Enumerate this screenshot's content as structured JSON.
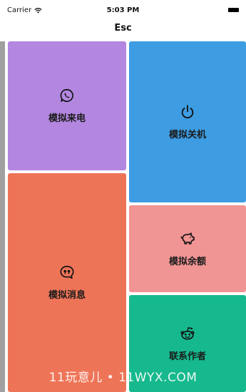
{
  "status_bar": {
    "carrier": "Carrier",
    "time": "5:03 PM"
  },
  "nav": {
    "title": "Esc"
  },
  "tiles": [
    {
      "label": "模拟来电",
      "color": "#b386e0",
      "icon": "whatsapp-phone-icon"
    },
    {
      "label": "模拟关机",
      "color": "#3d9ce2",
      "icon": "power-icon"
    },
    {
      "label": "模拟消息",
      "color": "#ee7458",
      "icon": "quote-bubble-icon"
    },
    {
      "label": "模拟余额",
      "color": "#f19494",
      "icon": "piggy-bank-icon"
    },
    {
      "label": "联系作者",
      "color": "#16b98d",
      "icon": "reddit-alien-icon"
    }
  ],
  "watermark": "11玩意儿 • 11WYX.COM"
}
